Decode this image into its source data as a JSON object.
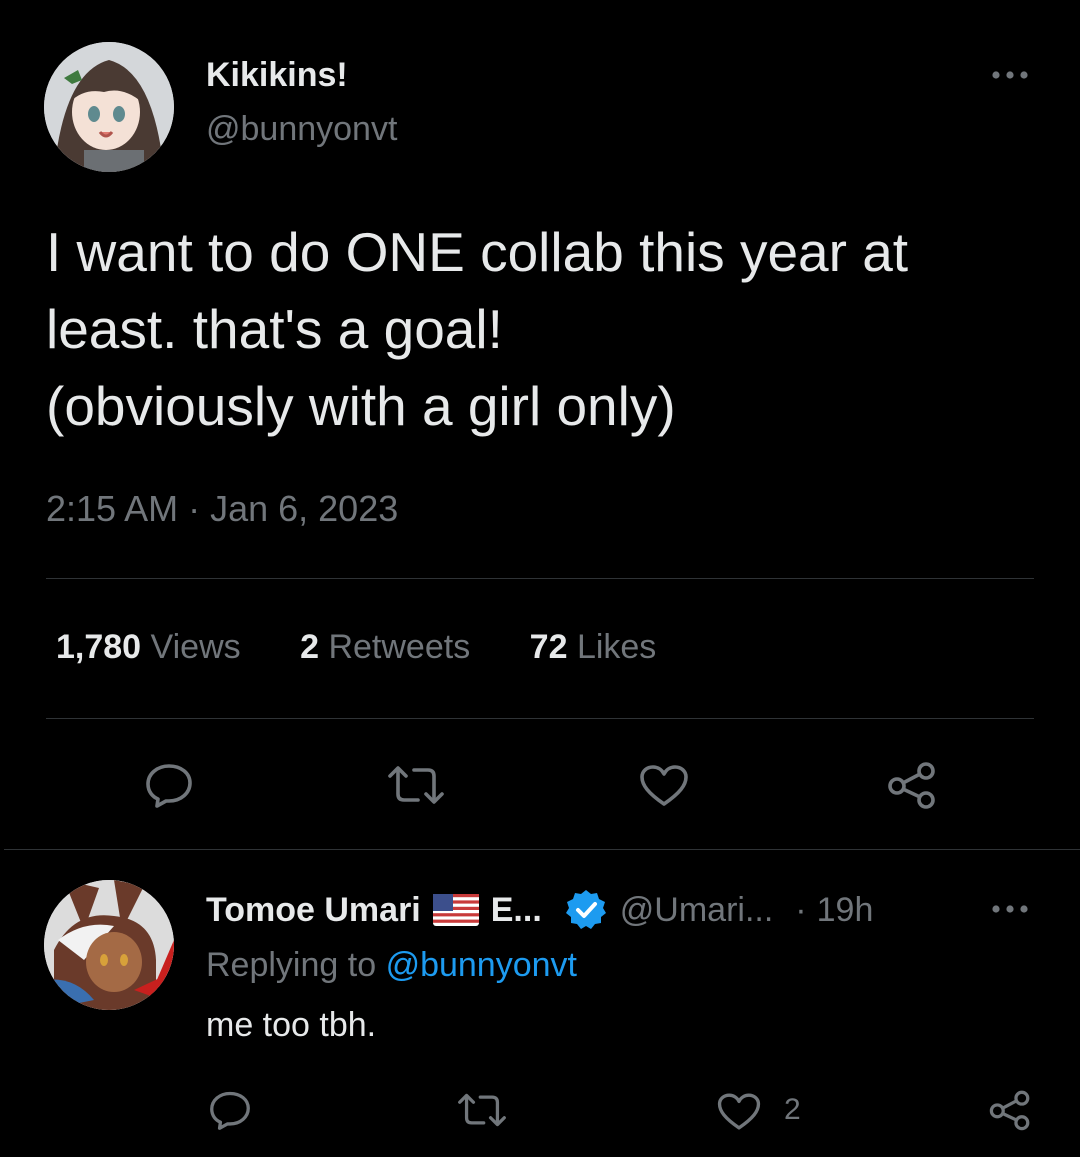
{
  "main_tweet": {
    "author_name": "Kikikins!",
    "handle": "@bunnyonvt",
    "text_lines": [
      "I want to do ONE collab this year at",
      "least. that's a goal!",
      "(obviously with a girl only)"
    ],
    "timestamp": "2:15 AM · Jan 6, 2023",
    "stats": {
      "views_count": "1,780",
      "views_label": "Views",
      "retweets_count": "2",
      "retweets_label": "Retweets",
      "likes_count": "72",
      "likes_label": "Likes"
    },
    "actions": [
      "reply-icon",
      "retweet-icon",
      "like-icon",
      "share-icon"
    ]
  },
  "reply": {
    "author_name": "Tomoe Umari",
    "name_suffix": "E...",
    "flag": "us-flag-icon",
    "verified": "verified-badge-icon",
    "handle": "@Umari...",
    "separator": "·",
    "time": "19h",
    "replying_prefix": "Replying to",
    "replying_to": "@bunnyonvt",
    "text": "me too tbh.",
    "like_count": "2",
    "actions": [
      "reply-icon",
      "retweet-icon",
      "like-icon",
      "share-icon"
    ]
  },
  "colors": {
    "background": "#000000",
    "primary_text": "#e7e9ea",
    "secondary_text": "#71767b",
    "link": "#1d9bf0",
    "divider": "#2f3336"
  }
}
